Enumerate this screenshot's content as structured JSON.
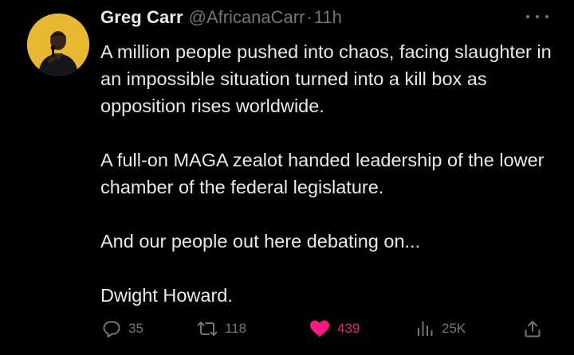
{
  "tweet": {
    "author": {
      "display_name": "Greg Carr",
      "handle": "@AfricanaCarr",
      "separator": "·",
      "time": "11h"
    },
    "paragraphs": [
      "A million people pushed into chaos, facing slaughter in an impossible situation turned into a kill box as opposition rises worldwide.",
      "A full-on MAGA zealot handed leadership of the lower chamber of the federal legislature.",
      "And our people out here debating on...",
      "Dwight Howard."
    ],
    "metrics": {
      "replies": "35",
      "retweets": "118",
      "likes": "439",
      "views": "25K"
    },
    "icons": {
      "reply": "reply-icon",
      "retweet": "retweet-icon",
      "like": "heart-icon",
      "views": "views-icon",
      "share": "share-icon",
      "more": "more-icon"
    },
    "colors": {
      "background": "#000000",
      "text": "#e7e9ea",
      "muted": "#71767b",
      "like_active": "#f91880",
      "avatar_background": "#e8b832"
    },
    "liked": true
  }
}
